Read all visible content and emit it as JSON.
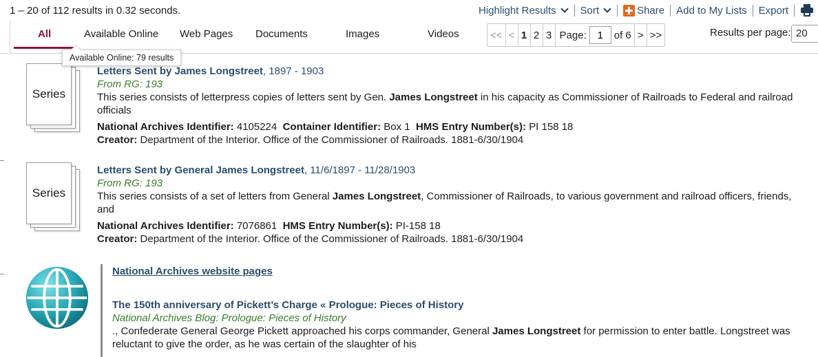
{
  "summary": {
    "text": "1 – 20 of 112 results in 0.32 seconds."
  },
  "actions": {
    "highlight": "Highlight Results",
    "sort": "Sort",
    "share": "Share",
    "add_to_lists": "Add to My Lists",
    "export": "Export"
  },
  "tabs": [
    {
      "label": "All",
      "active": true
    },
    {
      "label": "Available Online"
    },
    {
      "label": "Web Pages"
    },
    {
      "label": "Documents"
    },
    {
      "label": "Images"
    },
    {
      "label": "Videos"
    }
  ],
  "tooltip": {
    "text": "Available Online: 79 results"
  },
  "pager": {
    "first": "<<",
    "prev": "<",
    "pages": [
      "1",
      "2",
      "3"
    ],
    "page_label": "Page:",
    "page_value": "1",
    "of_label": "of 6",
    "next": ">",
    "last": ">>"
  },
  "results_per_page": {
    "label": "Results per page:",
    "value": "20"
  },
  "results": [
    {
      "thumb": "Series",
      "title_pre": "Letters Sent by ",
      "title_bold": "James Longstreet",
      "title_dates": ", 1897 - 1903",
      "from": "From RG: 193",
      "desc_pre": "This series consists of letterpress copies of letters sent by Gen. ",
      "desc_bold": "James Longstreet",
      "desc_post": " in his capacity as Commissioner of Railroads to Federal and railroad officials",
      "naid_label": "National Archives Identifier:",
      "naid": "4105224",
      "container_label": "Container Identifier:",
      "container": "Box 1",
      "hms_label": "HMS Entry Number(s):",
      "hms": "PI 158 18",
      "creator_label": "Creator:",
      "creator": "Department of the Interior. Office of the Commissioner of Railroads. 1881-6/30/1904"
    },
    {
      "thumb": "Series",
      "title_pre": "Letters Sent by ",
      "title_bold": "General James Longstreet",
      "title_dates": ", 11/6/1897 - 11/28/1903",
      "from": "From RG: 193",
      "desc_pre": "This series consists of a set of letters from General ",
      "desc_bold": "James Longstreet",
      "desc_post": ", Commissioner of Railroads, to various government and railroad officers, friends, and",
      "naid_label": "National Archives Identifier:",
      "naid": "7076861",
      "hms_label": "HMS Entry Number(s):",
      "hms": "PI-158 18",
      "creator_label": "Creator:",
      "creator": "Department of the Interior. Office of the Commissioner of Railroads. 1881-6/30/1904"
    }
  ],
  "web": {
    "heading": "National Archives website pages",
    "title": "The 150th anniversary of Pickett’s Charge « Prologue: Pieces of History",
    "source": "National Archives Blog: Prologue: Pieces of History",
    "desc_pre": "., Confederate General George Pickett approached his corps commander, General ",
    "desc_bold": "James Longstreet",
    "desc_post": " for permission to enter battle. Longstreet was reluctant to give the order, as he was certain of the slaughter of his"
  },
  "colors": {
    "accent": "#8a1538",
    "link": "#2b4d6e",
    "source_green": "#3a7d28",
    "share_orange": "#e36b1e"
  },
  "icons": [
    "chevron-down-icon",
    "plus-square-icon",
    "printer-icon",
    "globe-icon",
    "series-stack-icon"
  ]
}
